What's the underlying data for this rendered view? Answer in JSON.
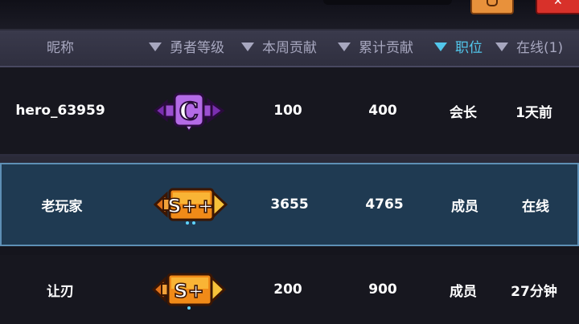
{
  "header": {
    "columns": [
      {
        "label": "昵称",
        "sortable": false,
        "active": false
      },
      {
        "label": "勇者等级",
        "sortable": true,
        "active": false
      },
      {
        "label": "本周贡献",
        "sortable": true,
        "active": false
      },
      {
        "label": "累计贡献",
        "sortable": true,
        "active": false
      },
      {
        "label": "职位",
        "sortable": true,
        "active": true
      },
      {
        "label": "在线(1)",
        "sortable": true,
        "active": false
      }
    ]
  },
  "rows": [
    {
      "name": "hero_63959",
      "rank": "C",
      "rank_color": "#8a3fc4",
      "weekly": "100",
      "total": "400",
      "role": "会长",
      "online": "1天前",
      "selected": false
    },
    {
      "name": "老玩家",
      "rank": "S++",
      "rank_color": "#f08a18",
      "weekly": "3655",
      "total": "4765",
      "role": "成员",
      "online": "在线",
      "selected": true
    },
    {
      "name": "让刃",
      "rank": "S+",
      "rank_color": "#f08a18",
      "weekly": "200",
      "total": "900",
      "role": "成员",
      "online": "27分钟",
      "selected": false
    }
  ],
  "colors": {
    "header_text": "#a7a7bf",
    "active_sort": "#52c7ec",
    "selected_row": "#1f3a52",
    "selected_border": "#5e8fb5"
  },
  "icons": [
    "settings-button-icon",
    "close-button-icon",
    "sort-arrow-icon",
    "rank-badge-icon"
  ]
}
